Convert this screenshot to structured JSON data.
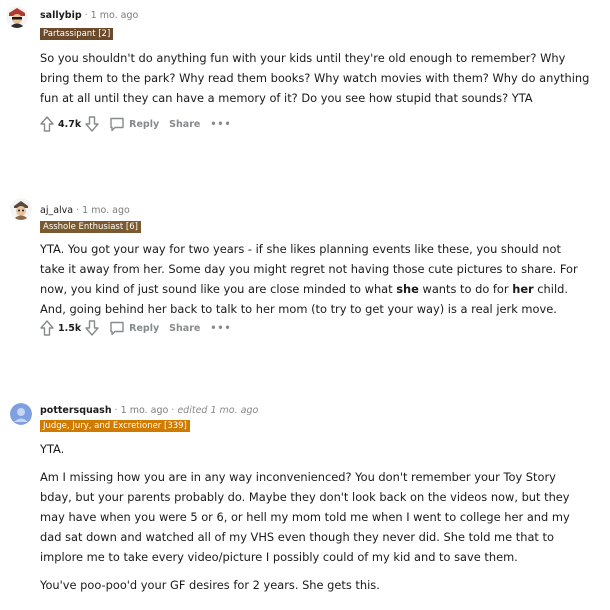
{
  "comments": [
    {
      "username": "sallybip",
      "time": "1 mo. ago",
      "flair": "Partassipant [2]",
      "body": [
        "So you shouldn't do anything fun with your kids until they're old enough to remember? Why bring them to the park? Why read them books? Why watch movies with them? Why do anything fun at all until they can have a memory of it? Do you see how stupid that sounds? YTA"
      ],
      "votes": "4.7k",
      "reply_label": "Reply",
      "share_label": "Share",
      "more_label": "•••"
    },
    {
      "username": "aj_alva",
      "time": "1 mo. ago",
      "flair": "Asshole Enthusiast [6]",
      "body_parts": {
        "part1": "YTA. You got your way for two years - if she likes planning events like these, you should not take it away from her. Some day you might regret not having those cute pictures to share. For now, you kind of just sound like you are close minded to what ",
        "bold1": "she",
        "part2": " wants to do for ",
        "bold2": "her",
        "part3": " child. And, going behind her back to talk to her mom (to try to get your way) is a real jerk move."
      },
      "votes": "1.5k",
      "reply_label": "Reply",
      "share_label": "Share",
      "more_label": "•••"
    },
    {
      "username": "pottersquash",
      "time": "1 mo. ago",
      "edited": "edited 1 mo. ago",
      "flair": "Judge, Jury, and Excretioner [339]",
      "body": [
        "YTA.",
        "Am I missing how you are in any way inconvenienced? You don't remember your Toy Story bday, but your parents probably do. Maybe they don't look back on the videos now, but they may have when you were 5 or 6, or hell my mom told me when I went to college her and my dad sat down and watched all of my VHS even though they never did. She told me that to implore me to take every video/picture I possibly could of my kid and to save them.",
        "You've poo-poo'd your GF desires for 2 years. She gets this."
      ]
    }
  ],
  "separator": "·"
}
